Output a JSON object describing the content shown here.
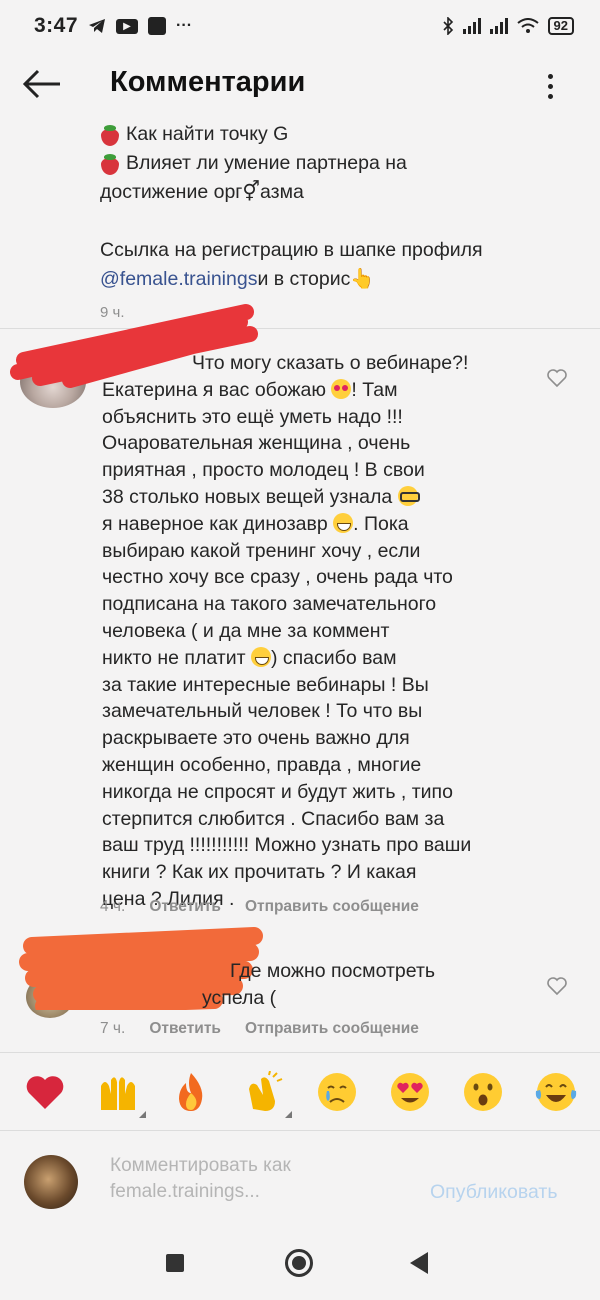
{
  "status_bar": {
    "time": "3:47",
    "battery": "92"
  },
  "header": {
    "title": "Комментарии"
  },
  "caption": {
    "lines": [
      "Как найти точку G",
      "Влияет ли умение партнера на",
      "достижение орг⚥азма",
      "Ссылка на регистрацию в шапке профиля"
    ],
    "mention": "@female.trainings",
    "mention_suffix": " и в сторис👆",
    "time": "9 ч."
  },
  "comments": [
    {
      "lines": [
        "Что могу сказать о вебинаре?!",
        "Екатерина я вас обожаю",
        "! Там",
        "объяснить это ещё уметь надо !!!",
        "Очаровательная женщина , очень",
        "приятная , просто молодец ! В свои",
        "38 столько новых вещей узнала",
        "я наверное как динозавр",
        ". Пока",
        "выбираю какой тренинг хочу , если",
        "честно хочу все сразу , очень рада что",
        "подписана на такого замечательного",
        "человека ( и да мне за коммент",
        "никто не платит",
        ") спасибо вам",
        "за такие интересные вебинары ! Вы",
        "замечательный человек ! То что вы",
        "раскрываете это очень важно для",
        "женщин особенно, правда , многие",
        "никогда не спросят и будут жить , типо",
        "стерпится слюбится . Спасибо вам за",
        "ваш труд !!!!!!!!!!! Можно узнать про ваши",
        "книги ? Как их прочитать ? И какая",
        "цена ? Лилия ."
      ],
      "time": "4 ч.",
      "reply": "Ответить",
      "send": "Отправить сообщение"
    },
    {
      "lines": [
        "Где можно посмотреть",
        "успела ("
      ],
      "time": "7 ч.",
      "reply": "Ответить",
      "send": "Отправить сообщение"
    }
  ],
  "reactions": [
    "heart",
    "raised-hands",
    "fire",
    "clapping-hands",
    "crying-face",
    "heart-eyes",
    "surprised-face",
    "tears-of-joy"
  ],
  "composer": {
    "placeholder": "Комментировать как\nfemale.trainings...",
    "publish": "Опубликовать"
  },
  "colors": {
    "accent_link": "#38528f",
    "publish_disabled": "#b7d3ee",
    "redaction": "#e8363a",
    "redaction_orange": "#f26a3a"
  }
}
